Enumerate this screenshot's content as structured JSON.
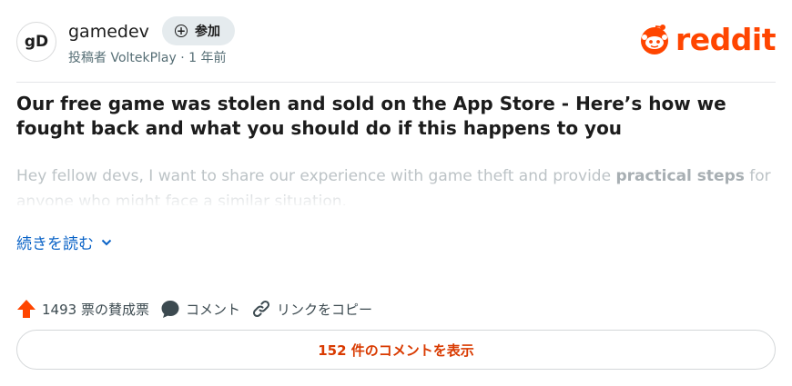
{
  "post_header": {
    "avatar_text": "gD",
    "subreddit": "gamedev",
    "join_label": "参加",
    "meta": "投稿者 VoltekPlay · 1 年前"
  },
  "brand": {
    "logo_text": "reddit",
    "accent_color": "#ff4500"
  },
  "post": {
    "title": "Our free game was stolen and sold on the App Store - Here’s how we fought back and what you should do if this happens to you",
    "body_part1": "Hey fellow devs, I want to share our experience with game theft and provide ",
    "body_bold": "practical steps",
    "body_part2": " for anyone who might face a similar situation.",
    "read_more": "続きを読む"
  },
  "actions": {
    "votes": "1493 票の賛成票",
    "comment": "コメント",
    "copy_link": "リンクをコピー"
  },
  "comments_button": "152 件のコメントを表示"
}
